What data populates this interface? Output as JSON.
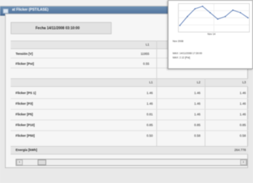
{
  "window": {
    "title": "at Flicker (PST/LASE)"
  },
  "table": {
    "date_header": "Fecha 14/11/2008 03:10:00",
    "top_section": {
      "column_header": "L1",
      "rows": [
        {
          "label": "Tensión [V]",
          "value": "11955"
        },
        {
          "label": "Flicker [Pst]",
          "value": "0.55"
        }
      ]
    },
    "phase_section": {
      "column_headers": [
        "L1",
        "L2",
        "L3"
      ],
      "rows": [
        {
          "label": "Flicker [PS 1]",
          "values": [
            "1.46",
            "1.46",
            "1.46"
          ]
        },
        {
          "label": "Flicker [P3]",
          "values": [
            "1.46",
            "1.46",
            "1.46"
          ]
        },
        {
          "label": "Flicker [P5]",
          "values": [
            "0.81",
            "1.46",
            "1.46"
          ]
        },
        {
          "label": "Flicker [P10]",
          "values": [
            "0.85",
            "0.85",
            "0.85"
          ]
        },
        {
          "label": "Flicker [P50]",
          "values": [
            "0.50",
            "0.58",
            "0.58"
          ]
        }
      ]
    },
    "energy_row": {
      "label": "Energía [kWh]",
      "value": "264.778"
    }
  },
  "scrollbar": {
    "left_arrow": "‹",
    "right_arrow": "›"
  },
  "chart_popup": {
    "x_label": "Nov 14",
    "x_sublabel": "Nov 2008",
    "info_lines": [
      "MAX: 14/11/2008 17:30:00",
      "MAX: 2.12 [Pst]"
    ],
    "chart_data": {
      "type": "line",
      "title": "",
      "series": [
        {
          "values": [
            0.2,
            0.55,
            0.85,
            0.95,
            0.7,
            0.45,
            0.55,
            0.8,
            0.7,
            0.5
          ]
        }
      ]
    }
  }
}
